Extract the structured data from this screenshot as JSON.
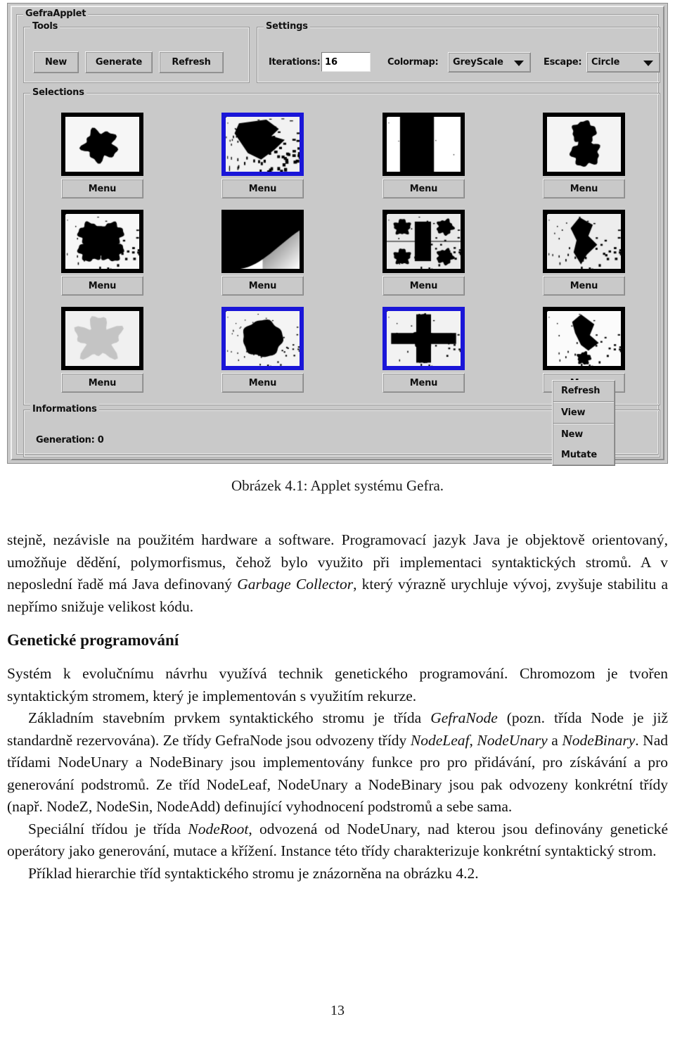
{
  "applet": {
    "window_title": "GefraApplet",
    "tools": {
      "title": "Tools",
      "buttons": [
        {
          "label": "New"
        },
        {
          "label": "Generate"
        },
        {
          "label": "Refresh"
        }
      ]
    },
    "settings": {
      "title": "Settings",
      "iterations_label": "Iterations:",
      "iterations_value": "16",
      "colormap_label": "Colormap:",
      "colormap_value": "GreyScale",
      "escape_label": "Escape:",
      "escape_value": "Circle"
    },
    "selections": {
      "title": "Selections",
      "menu_label": "Menu",
      "selected_color": "#1a16d8",
      "cells": [
        {
          "index": 1,
          "row": 1,
          "col": 1,
          "selected": false,
          "fractal": "round-blob"
        },
        {
          "index": 2,
          "row": 1,
          "col": 2,
          "selected": true,
          "fractal": "jagged-coast"
        },
        {
          "index": 3,
          "row": 1,
          "col": 3,
          "selected": false,
          "fractal": "dark-band"
        },
        {
          "index": 4,
          "row": 1,
          "col": 4,
          "selected": false,
          "fractal": "vertical-lobes"
        },
        {
          "index": 5,
          "row": 2,
          "col": 1,
          "selected": false,
          "fractal": "butterfly"
        },
        {
          "index": 6,
          "row": 2,
          "col": 2,
          "selected": false,
          "fractal": "dark-sweep"
        },
        {
          "index": 7,
          "row": 2,
          "col": 3,
          "selected": false,
          "fractal": "mirrored-corners"
        },
        {
          "index": 8,
          "row": 2,
          "col": 4,
          "selected": false,
          "fractal": "spiky-column"
        },
        {
          "index": 9,
          "row": 3,
          "col": 1,
          "selected": false,
          "fractal": "pale-ghost"
        },
        {
          "index": 10,
          "row": 3,
          "col": 2,
          "selected": true,
          "fractal": "speckled-disc"
        },
        {
          "index": 11,
          "row": 3,
          "col": 3,
          "selected": true,
          "fractal": "cross-star"
        },
        {
          "index": 12,
          "row": 3,
          "col": 4,
          "selected": false,
          "fractal": "diagonal-streak"
        }
      ]
    },
    "informations": {
      "title": "Informations",
      "generation_text": "Generation: 0"
    },
    "context_menu": {
      "items": [
        "Refresh",
        "View",
        "New",
        "Mutate"
      ]
    }
  },
  "document": {
    "figure_caption": "Obrázek 4.1: Applet systému Gefra.",
    "paragraph1": {
      "part1": "stejně, nezávisle na použitém hardware a software. Programovací jazyk Java je objektově orientovaný, umožňuje dědění, polymorfismus, čehož bylo využito při implementaci syntaktických stromů. A v neposlední řadě má Java definovaný ",
      "italic1": "Garbage Collector",
      "part2": ", který výrazně urychluje vývoj, zvyšuje stabilitu a nepřímo snižuje velikost kódu."
    },
    "heading": "Genetické programování",
    "paragraph2": "Systém k evolučnímu návrhu využívá technik genetického programování. Chromozom je tvořen syntaktickým stromem, který je implementován s využitím rekurze.",
    "paragraph3": {
      "part1": "Základním stavebním prvkem syntaktického stromu je třída ",
      "italic1": "GefraNode",
      "part2": " (pozn. třída Node je již standardně rezervována). Ze třídy GefraNode jsou odvozeny třídy ",
      "italic2": "NodeLeaf",
      "part3": ", ",
      "italic3": "NodeUnary",
      "part4": " a ",
      "italic4": "NodeBinary",
      "part5": ". Nad třídami NodeUnary a NodeBinary jsou implementovány funkce pro pro přidávání, pro získávání a pro generování podstromů. Ze tříd NodeLeaf, NodeUnary a NodeBinary jsou pak odvozeny konkrétní třídy (např. NodeZ, NodeSin, NodeAdd) definující vyhodnocení podstromů a sebe sama."
    },
    "paragraph4": {
      "part1": "Speciální třídou je třída ",
      "italic1": "NodeRoot",
      "part2": ", odvozená od NodeUnary, nad kterou jsou definovány genetické operátory jako generování, mutace a křížení. Instance této třídy charakterizuje konkrétní syntaktický strom."
    },
    "paragraph5": "Příklad hierarchie tříd syntaktického stromu je znázorněna na obrázku 4.2.",
    "page_number": "13"
  }
}
